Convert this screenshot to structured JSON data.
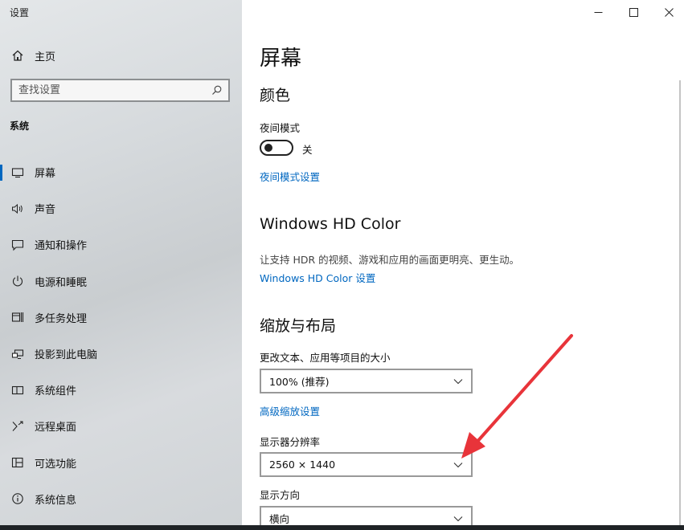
{
  "window": {
    "title": "设置"
  },
  "sidebar": {
    "home_label": "主页",
    "search_placeholder": "查找设置",
    "group_label": "系统",
    "items": [
      {
        "label": "屏幕",
        "icon": "monitor-icon"
      },
      {
        "label": "声音",
        "icon": "speaker-icon"
      },
      {
        "label": "通知和操作",
        "icon": "notification-icon"
      },
      {
        "label": "电源和睡眠",
        "icon": "power-icon"
      },
      {
        "label": "多任务处理",
        "icon": "multitask-icon"
      },
      {
        "label": "投影到此电脑",
        "icon": "project-icon"
      },
      {
        "label": "系统组件",
        "icon": "components-icon"
      },
      {
        "label": "远程桌面",
        "icon": "remote-icon"
      },
      {
        "label": "可选功能",
        "icon": "optional-features-icon"
      },
      {
        "label": "系统信息",
        "icon": "info-icon"
      }
    ],
    "active_index": 0
  },
  "main": {
    "title": "屏幕",
    "color_section": "颜色",
    "night_mode_label": "夜间模式",
    "night_mode_state": "关",
    "night_mode_link": "夜间模式设置",
    "hdr_section": "Windows HD Color",
    "hdr_desc": "让支持 HDR 的视频、游戏和应用的画面更明亮、更生动。",
    "hdr_link": "Windows HD Color 设置",
    "layout_section": "缩放与布局",
    "scale_label": "更改文本、应用等项目的大小",
    "scale_value": "100% (推荐)",
    "advanced_scale_link": "高级缩放设置",
    "resolution_label": "显示器分辨率",
    "resolution_value": "2560 × 1440",
    "orientation_label": "显示方向",
    "orientation_value": "横向"
  },
  "colors": {
    "accent": "#0067c0",
    "arrow": "#e8343a"
  }
}
